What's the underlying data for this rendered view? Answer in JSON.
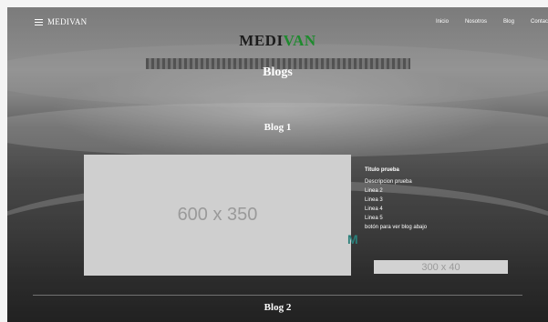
{
  "header": {
    "brand": "MEDIVAN",
    "menu_icon": "hamburger-icon",
    "nav": [
      "Inicio",
      "Nosotros",
      "Blog",
      "Contac"
    ]
  },
  "logo": {
    "part1": "MEDI",
    "part2": "VAN",
    "color1": "#1c1c1c",
    "color2": "#1e8a2e"
  },
  "page_title": "Blogs",
  "blog1": {
    "title": "Blog 1",
    "image_placeholder": "600 x 350",
    "post_title": "Titulo prueba",
    "lines": [
      "Descripcion prueba",
      "Linea 2",
      "Linea 3",
      "Linea 4",
      "Linea 5",
      "botón para ver blog abajo"
    ],
    "button_placeholder": "300 x 40"
  },
  "blog2": {
    "title": "Blog 2"
  }
}
